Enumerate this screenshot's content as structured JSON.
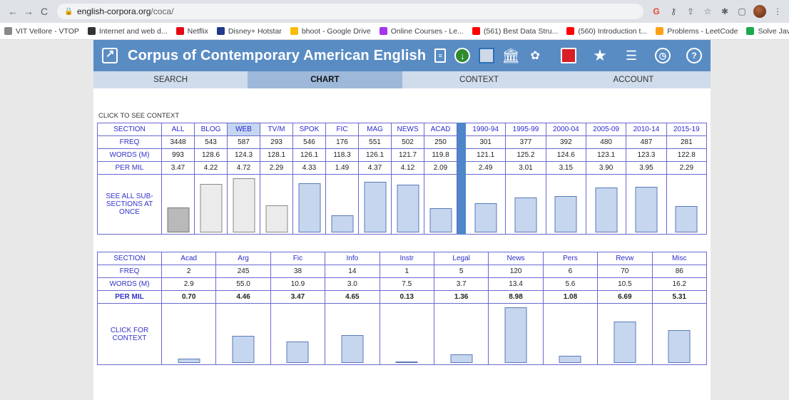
{
  "browser": {
    "url_host": "english-corpora.org",
    "url_path": "/coca/",
    "bookmarks": [
      {
        "label": "VIT Vellore - VTOP",
        "color": "#888"
      },
      {
        "label": "Internet and web d...",
        "color": "#333"
      },
      {
        "label": "Netflix",
        "color": "#e50914"
      },
      {
        "label": "Disney+ Hotstar",
        "color": "#1f3a8a"
      },
      {
        "label": "bhoot - Google Drive",
        "color": "#fbbc04"
      },
      {
        "label": "Online Courses - Le...",
        "color": "#a435f0"
      },
      {
        "label": "(561) Best Data Stru...",
        "color": "#ff0000"
      },
      {
        "label": "(560) Introduction t...",
        "color": "#ff0000"
      },
      {
        "label": "Problems - LeetCode",
        "color": "#ffa116"
      },
      {
        "label": "Solve Java | Hacker...",
        "color": "#1ba94c"
      }
    ],
    "more": "»"
  },
  "banner": {
    "title": "Corpus of Contemporary American English"
  },
  "tabs": [
    "SEARCH",
    "CHART",
    "CONTEXT",
    "ACCOUNT"
  ],
  "active_tab": "CHART",
  "click_to_see_context": "CLICK TO SEE CONTEXT",
  "table1": {
    "row_labels": {
      "section": "SECTION",
      "freq": "FREQ",
      "words": "WORDS (M)",
      "permil": "PER MIL",
      "see_all": "SEE ALL SUB-SECTIONS AT ONCE"
    },
    "genres": [
      {
        "section": "ALL",
        "freq": "3448",
        "words": "993",
        "permil": "3.47",
        "bar": 0.45,
        "style": "gray"
      },
      {
        "section": "BLOG",
        "freq": "543",
        "words": "128.6",
        "permil": "4.22",
        "bar": 0.87,
        "style": "light"
      },
      {
        "section": "WEB",
        "freq": "587",
        "words": "124.3",
        "permil": "4.72",
        "bar": 0.97,
        "style": "light"
      },
      {
        "section": "TV/M",
        "freq": "293",
        "words": "128.1",
        "permil": "2.29",
        "bar": 0.49,
        "style": "light"
      },
      {
        "section": "SPOK",
        "freq": "546",
        "words": "126.1",
        "permil": "4.33",
        "bar": 0.89,
        "style": "blue"
      },
      {
        "section": "FIC",
        "freq": "176",
        "words": "118.3",
        "permil": "1.49",
        "bar": 0.31,
        "style": "blue"
      },
      {
        "section": "MAG",
        "freq": "551",
        "words": "126.1",
        "permil": "4.37",
        "bar": 0.91,
        "style": "blue"
      },
      {
        "section": "NEWS",
        "freq": "502",
        "words": "121.7",
        "permil": "4.12",
        "bar": 0.86,
        "style": "blue"
      },
      {
        "section": "ACAD",
        "freq": "250",
        "words": "119.8",
        "permil": "2.09",
        "bar": 0.43,
        "style": "blue"
      }
    ],
    "periods": [
      {
        "section": "1990-94",
        "freq": "301",
        "words": "121.1",
        "permil": "2.49",
        "bar": 0.52
      },
      {
        "section": "1995-99",
        "freq": "377",
        "words": "125.2",
        "permil": "3.01",
        "bar": 0.63
      },
      {
        "section": "2000-04",
        "freq": "392",
        "words": "124.6",
        "permil": "3.15",
        "bar": 0.65
      },
      {
        "section": "2005-09",
        "freq": "480",
        "words": "123.1",
        "permil": "3.90",
        "bar": 0.81
      },
      {
        "section": "2010-14",
        "freq": "487",
        "words": "123.3",
        "permil": "3.95",
        "bar": 0.82
      },
      {
        "section": "2015-19",
        "freq": "281",
        "words": "122.8",
        "permil": "2.29",
        "bar": 0.48
      }
    ]
  },
  "table2": {
    "row_labels": {
      "section": "SECTION",
      "freq": "FREQ",
      "words": "WORDS (M)",
      "permil": "PER MIL",
      "click": "CLICK FOR CONTEXT"
    },
    "subs": [
      {
        "section": "Acad",
        "freq": "2",
        "words": "2.9",
        "permil": "0.70",
        "bar": 0.08
      },
      {
        "section": "Arg",
        "freq": "245",
        "words": "55.0",
        "permil": "4.46",
        "bar": 0.47
      },
      {
        "section": "Fic",
        "freq": "38",
        "words": "10.9",
        "permil": "3.47",
        "bar": 0.38
      },
      {
        "section": "Info",
        "freq": "14",
        "words": "3.0",
        "permil": "4.65",
        "bar": 0.49
      },
      {
        "section": "Instr",
        "freq": "1",
        "words": "7.5",
        "permil": "0.13",
        "bar": 0.02
      },
      {
        "section": "Legal",
        "freq": "5",
        "words": "3.7",
        "permil": "1.36",
        "bar": 0.15
      },
      {
        "section": "News",
        "freq": "120",
        "words": "13.4",
        "permil": "8.98",
        "bar": 0.98
      },
      {
        "section": "Pers",
        "freq": "6",
        "words": "5.6",
        "permil": "1.08",
        "bar": 0.12
      },
      {
        "section": "Revw",
        "freq": "70",
        "words": "10.5",
        "permil": "6.69",
        "bar": 0.73
      },
      {
        "section": "Misc",
        "freq": "86",
        "words": "16.2",
        "permil": "5.31",
        "bar": 0.58
      }
    ]
  }
}
